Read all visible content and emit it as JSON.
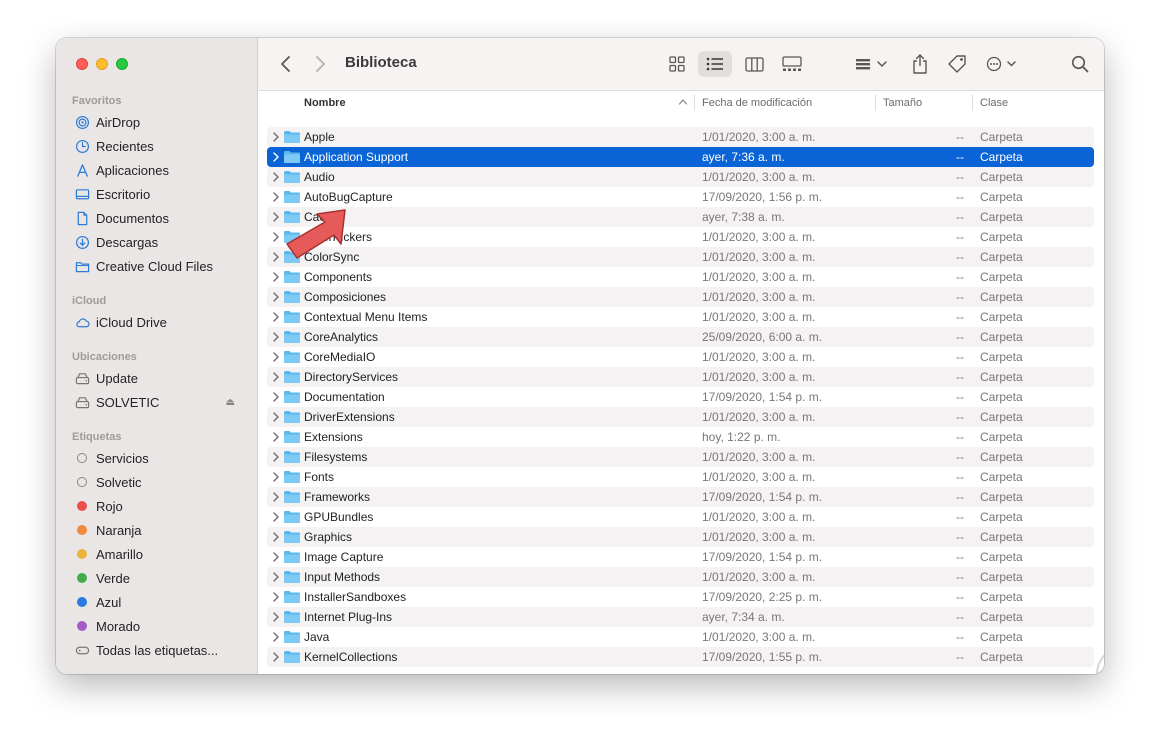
{
  "window": {
    "title": "Biblioteca"
  },
  "sidebar": {
    "favorites_heading": "Favoritos",
    "favorites": [
      {
        "label": "AirDrop",
        "icon": "airdrop-icon"
      },
      {
        "label": "Recientes",
        "icon": "clock-icon"
      },
      {
        "label": "Aplicaciones",
        "icon": "applications-icon"
      },
      {
        "label": "Escritorio",
        "icon": "desktop-icon"
      },
      {
        "label": "Documentos",
        "icon": "document-icon"
      },
      {
        "label": "Descargas",
        "icon": "download-icon"
      },
      {
        "label": "Creative Cloud Files",
        "icon": "folder-icon"
      }
    ],
    "icloud_heading": "iCloud",
    "icloud": [
      {
        "label": "iCloud Drive",
        "icon": "cloud-icon"
      }
    ],
    "locations_heading": "Ubicaciones",
    "locations": [
      {
        "label": "Update",
        "icon": "disk-icon"
      },
      {
        "label": "SOLVETIC",
        "icon": "disk-icon",
        "eject": "⏏"
      }
    ],
    "tags_heading": "Etiquetas",
    "tags": [
      {
        "label": "Servicios",
        "color": ""
      },
      {
        "label": "Solvetic",
        "color": ""
      },
      {
        "label": "Rojo",
        "color": "#eb4d4b"
      },
      {
        "label": "Naranja",
        "color": "#f08a3c"
      },
      {
        "label": "Amarillo",
        "color": "#e9b43a"
      },
      {
        "label": "Verde",
        "color": "#3fae4a"
      },
      {
        "label": "Azul",
        "color": "#2a7ae2"
      },
      {
        "label": "Morado",
        "color": "#a25bc7"
      },
      {
        "label": "Todas las etiquetas...",
        "color": "all"
      }
    ]
  },
  "columns": {
    "name": "Nombre",
    "date": "Fecha de modificación",
    "size": "Tamaño",
    "kind": "Clase"
  },
  "files": [
    {
      "name": "Apple",
      "date": "1/01/2020, 3:00 a. m.",
      "size": "--",
      "kind": "Carpeta"
    },
    {
      "name": "Application Support",
      "date": "ayer, 7:36 a. m.",
      "size": "--",
      "kind": "Carpeta",
      "selected": true
    },
    {
      "name": "Audio",
      "date": "1/01/2020, 3:00 a. m.",
      "size": "--",
      "kind": "Carpeta"
    },
    {
      "name": "AutoBugCapture",
      "date": "17/09/2020, 1:56 p. m.",
      "size": "--",
      "kind": "Carpeta"
    },
    {
      "name": "Caches",
      "date": "ayer, 7:38 a. m.",
      "size": "--",
      "kind": "Carpeta"
    },
    {
      "name": "ColorPickers",
      "date": "1/01/2020, 3:00 a. m.",
      "size": "--",
      "kind": "Carpeta"
    },
    {
      "name": "ColorSync",
      "date": "1/01/2020, 3:00 a. m.",
      "size": "--",
      "kind": "Carpeta"
    },
    {
      "name": "Components",
      "date": "1/01/2020, 3:00 a. m.",
      "size": "--",
      "kind": "Carpeta"
    },
    {
      "name": "Composiciones",
      "date": "1/01/2020, 3:00 a. m.",
      "size": "--",
      "kind": "Carpeta"
    },
    {
      "name": "Contextual Menu Items",
      "date": "1/01/2020, 3:00 a. m.",
      "size": "--",
      "kind": "Carpeta"
    },
    {
      "name": "CoreAnalytics",
      "date": "25/09/2020, 6:00 a. m.",
      "size": "--",
      "kind": "Carpeta"
    },
    {
      "name": "CoreMediaIO",
      "date": "1/01/2020, 3:00 a. m.",
      "size": "--",
      "kind": "Carpeta"
    },
    {
      "name": "DirectoryServices",
      "date": "1/01/2020, 3:00 a. m.",
      "size": "--",
      "kind": "Carpeta"
    },
    {
      "name": "Documentation",
      "date": "17/09/2020, 1:54 p. m.",
      "size": "--",
      "kind": "Carpeta"
    },
    {
      "name": "DriverExtensions",
      "date": "1/01/2020, 3:00 a. m.",
      "size": "--",
      "kind": "Carpeta"
    },
    {
      "name": "Extensions",
      "date": "hoy, 1:22 p. m.",
      "size": "--",
      "kind": "Carpeta"
    },
    {
      "name": "Filesystems",
      "date": "1/01/2020, 3:00 a. m.",
      "size": "--",
      "kind": "Carpeta"
    },
    {
      "name": "Fonts",
      "date": "1/01/2020, 3:00 a. m.",
      "size": "--",
      "kind": "Carpeta"
    },
    {
      "name": "Frameworks",
      "date": "17/09/2020, 1:54 p. m.",
      "size": "--",
      "kind": "Carpeta"
    },
    {
      "name": "GPUBundles",
      "date": "1/01/2020, 3:00 a. m.",
      "size": "--",
      "kind": "Carpeta"
    },
    {
      "name": "Graphics",
      "date": "1/01/2020, 3:00 a. m.",
      "size": "--",
      "kind": "Carpeta"
    },
    {
      "name": "Image Capture",
      "date": "17/09/2020, 1:54 p. m.",
      "size": "--",
      "kind": "Carpeta"
    },
    {
      "name": "Input Methods",
      "date": "1/01/2020, 3:00 a. m.",
      "size": "--",
      "kind": "Carpeta"
    },
    {
      "name": "InstallerSandboxes",
      "date": "17/09/2020, 2:25 p. m.",
      "size": "--",
      "kind": "Carpeta"
    },
    {
      "name": "Internet Plug-Ins",
      "date": "ayer, 7:34 a. m.",
      "size": "--",
      "kind": "Carpeta"
    },
    {
      "name": "Java",
      "date": "1/01/2020, 3:00 a. m.",
      "size": "--",
      "kind": "Carpeta"
    },
    {
      "name": "KernelCollections",
      "date": "17/09/2020, 1:55 p. m.",
      "size": "--",
      "kind": "Carpeta"
    }
  ],
  "colors": {
    "selection": "#0a64d6",
    "folder": "#5bb8ee",
    "arrow": "#e65a5a"
  }
}
